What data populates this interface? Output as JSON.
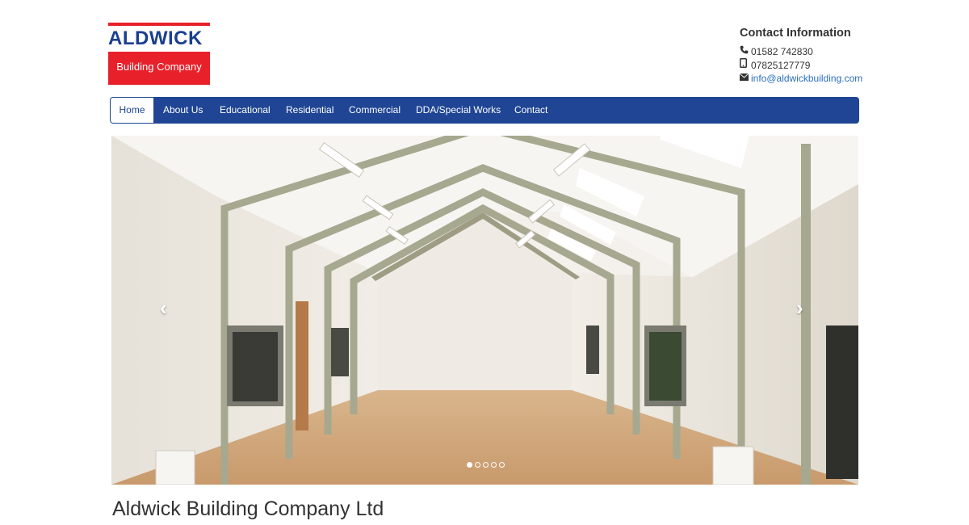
{
  "logo": {
    "name": "ALDWICK",
    "subtitle": "Building Company"
  },
  "contact": {
    "heading": "Contact Information",
    "phone": "01582 742830",
    "mobile": "07825127779",
    "email": "info@aldwickbuilding.com",
    "icons": [
      "phone-icon",
      "mobile-icon",
      "envelope-icon"
    ]
  },
  "nav": {
    "items": [
      {
        "label": "Home"
      },
      {
        "label": "About Us"
      },
      {
        "label": "Educational"
      },
      {
        "label": "Residential"
      },
      {
        "label": "Commercial"
      },
      {
        "label": "DDA/Special Works"
      },
      {
        "label": "Contact"
      }
    ],
    "active_index": 0
  },
  "carousel": {
    "prev": "‹",
    "next": "›",
    "slide_count": 5,
    "active_slide": 1
  },
  "page": {
    "title": "Aldwick Building Company Ltd"
  },
  "colors": {
    "brand_blue": "#1f4594",
    "brand_red": "#e8202a",
    "link": "#2a6ebb"
  }
}
